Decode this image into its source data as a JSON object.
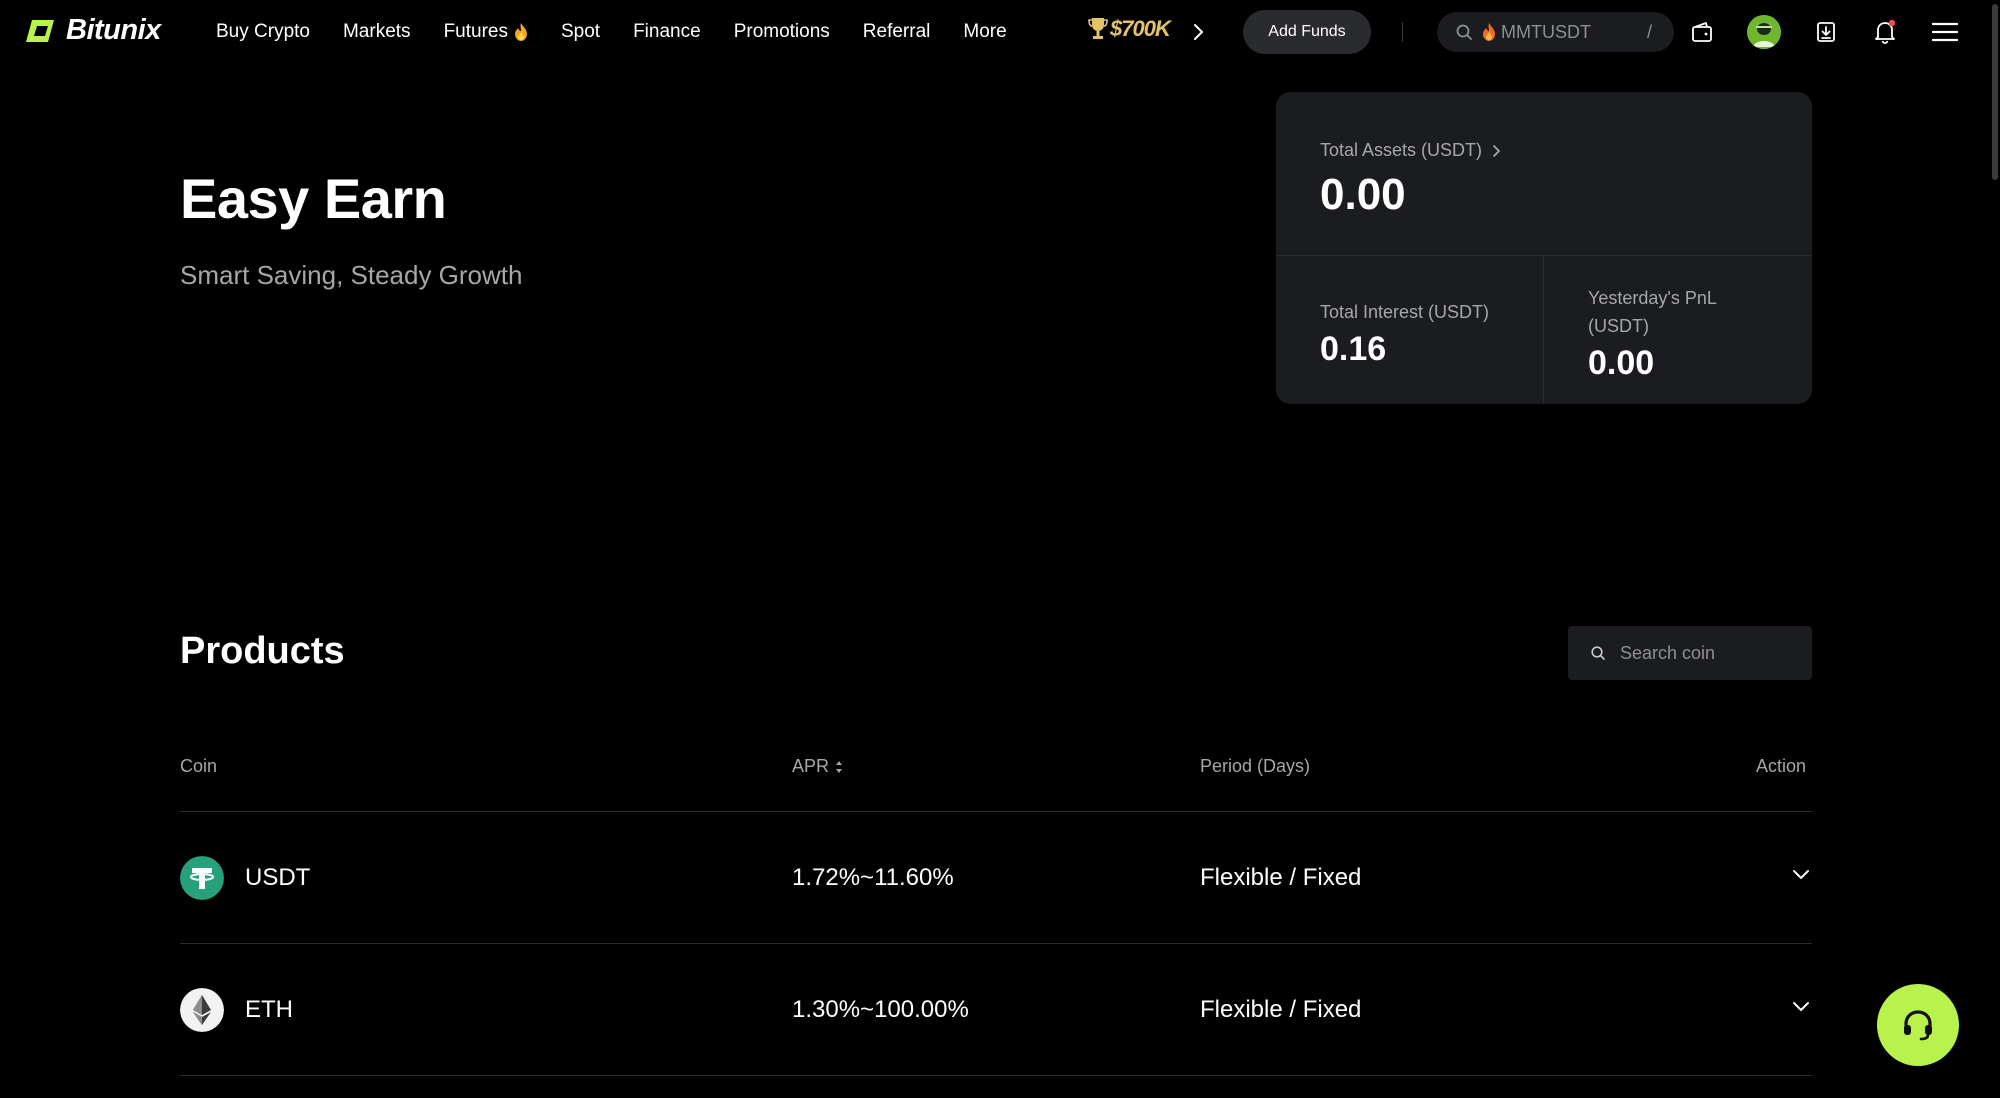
{
  "nav": {
    "logo_text": "Bitunix",
    "links": [
      {
        "label": "Buy Crypto"
      },
      {
        "label": "Markets"
      },
      {
        "label": "Futures"
      },
      {
        "label": "Spot"
      },
      {
        "label": "Finance"
      },
      {
        "label": "Promotions"
      },
      {
        "label": "Referral"
      },
      {
        "label": "More"
      }
    ],
    "promo_amount": "$700K",
    "add_funds_label": "Add Funds",
    "search_placeholder": "MMTUSDT",
    "search_shortcut": "/"
  },
  "hero": {
    "title": "Easy Earn",
    "subtitle": "Smart Saving, Steady Growth"
  },
  "assets": {
    "total_assets_label": "Total Assets (USDT)",
    "total_assets_value": "0.00",
    "total_interest_label": "Total Interest (USDT)",
    "total_interest_value": "0.16",
    "yesterday_pnl_label_line1": "Yesterday's PnL",
    "yesterday_pnl_label_line2": "(USDT)",
    "yesterday_pnl_value": "0.00"
  },
  "products": {
    "title": "Products",
    "search_placeholder": "Search coin",
    "columns": {
      "coin": "Coin",
      "apr": "APR",
      "period": "Period (Days)",
      "action": "Action"
    },
    "rows": [
      {
        "coin": "USDT",
        "apr": "1.72%~11.60%",
        "period": "Flexible / Fixed",
        "icon": "usdt-icon"
      },
      {
        "coin": "ETH",
        "apr": "1.30%~100.00%",
        "period": "Flexible / Fixed",
        "icon": "eth-icon"
      }
    ]
  },
  "colors": {
    "accent": "#b9f24a",
    "background": "#000000",
    "card": "#1b1c1f",
    "muted_text": "#a6a7ab",
    "usdt_green": "#26a17b",
    "promo_gold": "#e3c26a"
  }
}
